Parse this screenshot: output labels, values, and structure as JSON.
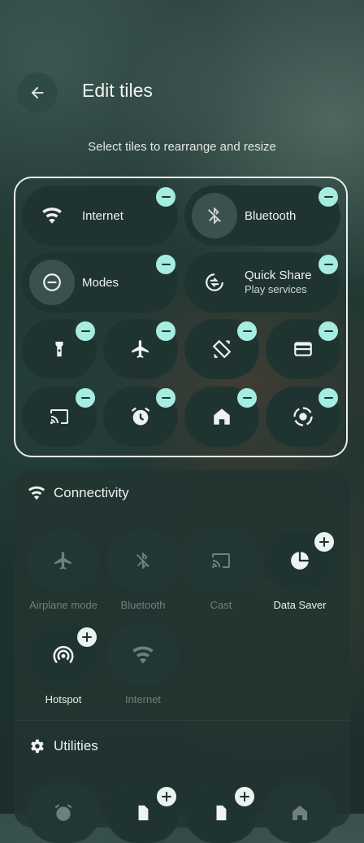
{
  "header": {
    "title": "Edit tiles",
    "subtitle": "Select tiles to rearrange and resize"
  },
  "current_tiles": {
    "wide": [
      {
        "label": "Internet",
        "icon": "wifi-icon"
      },
      {
        "label": "Bluetooth",
        "icon": "bluetooth-off-icon"
      },
      {
        "label": "Modes",
        "icon": "do-not-disturb-icon"
      },
      {
        "label": "Quick Share",
        "sublabel": "Play services",
        "icon": "quick-share-icon"
      }
    ],
    "small": [
      "flashlight-icon",
      "airplane-icon",
      "auto-rotate-icon",
      "wallet-icon",
      "cast-icon",
      "alarm-icon",
      "home-icon",
      "screen-record-icon"
    ]
  },
  "sections": [
    {
      "title": "Connectivity",
      "icon": "wifi-icon",
      "tiles": [
        {
          "label": "Airplane mode",
          "icon": "airplane-icon",
          "added": true
        },
        {
          "label": "Bluetooth",
          "icon": "bluetooth-off-icon",
          "added": true
        },
        {
          "label": "Cast",
          "icon": "cast-icon",
          "added": true
        },
        {
          "label": "Data Saver",
          "icon": "data-saver-icon",
          "added": false
        },
        {
          "label": "Hotspot",
          "icon": "hotspot-icon",
          "added": false
        },
        {
          "label": "Internet",
          "icon": "wifi-icon",
          "added": true
        }
      ]
    },
    {
      "title": "Utilities",
      "icon": "gear-icon",
      "tiles": [
        {
          "icon": "alarm-icon",
          "added": true
        },
        {
          "icon": "document-icon",
          "added": false
        },
        {
          "icon": "document-icon",
          "added": false
        },
        {
          "icon": "home-icon",
          "added": true
        }
      ]
    }
  ],
  "colors": {
    "accent": "#a6ece1",
    "outline": "#e7efec",
    "tile": "#1f3430"
  }
}
